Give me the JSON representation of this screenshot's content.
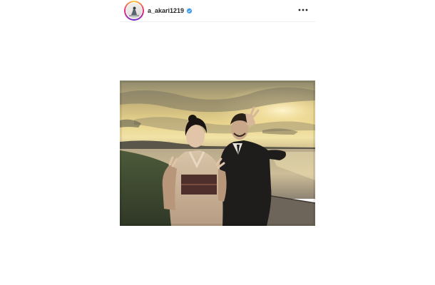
{
  "post": {
    "username": "a_akari1219",
    "verified": true,
    "icons": {
      "verified": "verified-badge-icon",
      "more": "more-options-icon"
    },
    "photo_subject": "sunset-seaside-portrait"
  },
  "colors": {
    "username_text": "#262626",
    "verified_blue": "#3897f0",
    "story_ring_start": "#f9ce34",
    "story_ring_mid": "#ee2a7b",
    "story_ring_end": "#6228d7"
  }
}
